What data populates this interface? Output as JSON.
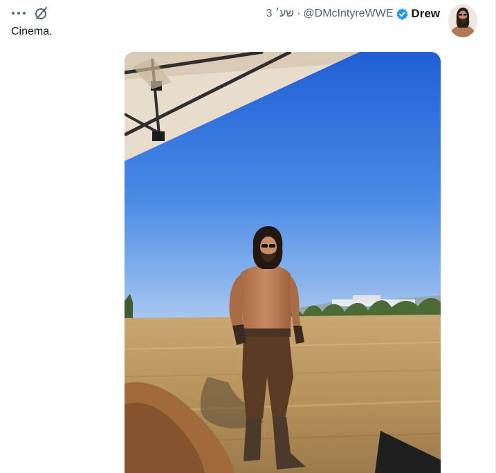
{
  "tweet": {
    "author": {
      "display_name": "Drew",
      "handle": "@DMcIntyreWWE",
      "verified": true
    },
    "time": "3 שע׳",
    "separator": "·",
    "text": "Cinema.",
    "icons": {
      "more": "more-horizontal-icon",
      "grok": "grok-icon",
      "verified": "verified-badge-icon"
    },
    "colors": {
      "verified": "#1d9bf0",
      "secondary_text": "#536471",
      "primary_text": "#0f1419"
    }
  }
}
